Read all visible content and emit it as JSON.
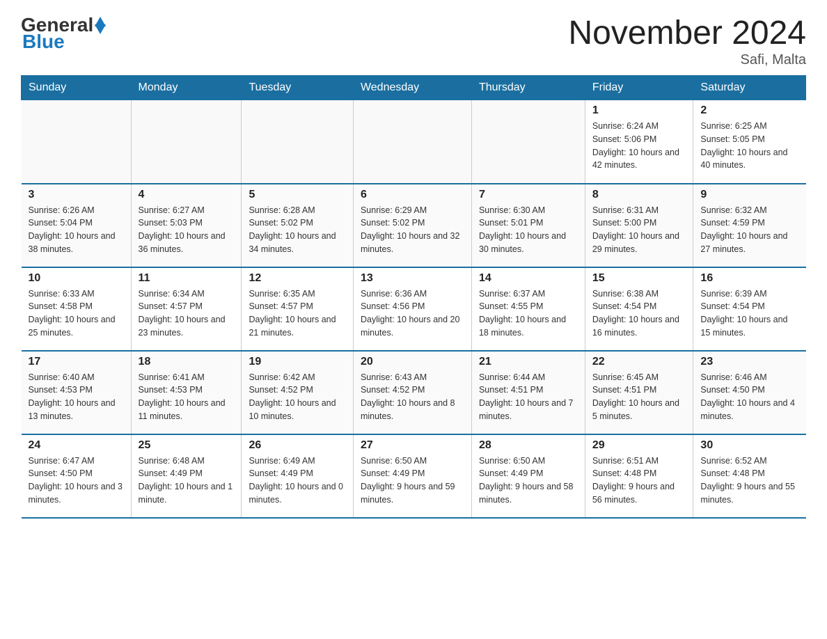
{
  "header": {
    "logo_general": "General",
    "logo_blue": "Blue",
    "month_title": "November 2024",
    "location": "Safi, Malta"
  },
  "days_of_week": [
    "Sunday",
    "Monday",
    "Tuesday",
    "Wednesday",
    "Thursday",
    "Friday",
    "Saturday"
  ],
  "weeks": [
    [
      {
        "day": "",
        "info": ""
      },
      {
        "day": "",
        "info": ""
      },
      {
        "day": "",
        "info": ""
      },
      {
        "day": "",
        "info": ""
      },
      {
        "day": "",
        "info": ""
      },
      {
        "day": "1",
        "info": "Sunrise: 6:24 AM\nSunset: 5:06 PM\nDaylight: 10 hours and 42 minutes."
      },
      {
        "day": "2",
        "info": "Sunrise: 6:25 AM\nSunset: 5:05 PM\nDaylight: 10 hours and 40 minutes."
      }
    ],
    [
      {
        "day": "3",
        "info": "Sunrise: 6:26 AM\nSunset: 5:04 PM\nDaylight: 10 hours and 38 minutes."
      },
      {
        "day": "4",
        "info": "Sunrise: 6:27 AM\nSunset: 5:03 PM\nDaylight: 10 hours and 36 minutes."
      },
      {
        "day": "5",
        "info": "Sunrise: 6:28 AM\nSunset: 5:02 PM\nDaylight: 10 hours and 34 minutes."
      },
      {
        "day": "6",
        "info": "Sunrise: 6:29 AM\nSunset: 5:02 PM\nDaylight: 10 hours and 32 minutes."
      },
      {
        "day": "7",
        "info": "Sunrise: 6:30 AM\nSunset: 5:01 PM\nDaylight: 10 hours and 30 minutes."
      },
      {
        "day": "8",
        "info": "Sunrise: 6:31 AM\nSunset: 5:00 PM\nDaylight: 10 hours and 29 minutes."
      },
      {
        "day": "9",
        "info": "Sunrise: 6:32 AM\nSunset: 4:59 PM\nDaylight: 10 hours and 27 minutes."
      }
    ],
    [
      {
        "day": "10",
        "info": "Sunrise: 6:33 AM\nSunset: 4:58 PM\nDaylight: 10 hours and 25 minutes."
      },
      {
        "day": "11",
        "info": "Sunrise: 6:34 AM\nSunset: 4:57 PM\nDaylight: 10 hours and 23 minutes."
      },
      {
        "day": "12",
        "info": "Sunrise: 6:35 AM\nSunset: 4:57 PM\nDaylight: 10 hours and 21 minutes."
      },
      {
        "day": "13",
        "info": "Sunrise: 6:36 AM\nSunset: 4:56 PM\nDaylight: 10 hours and 20 minutes."
      },
      {
        "day": "14",
        "info": "Sunrise: 6:37 AM\nSunset: 4:55 PM\nDaylight: 10 hours and 18 minutes."
      },
      {
        "day": "15",
        "info": "Sunrise: 6:38 AM\nSunset: 4:54 PM\nDaylight: 10 hours and 16 minutes."
      },
      {
        "day": "16",
        "info": "Sunrise: 6:39 AM\nSunset: 4:54 PM\nDaylight: 10 hours and 15 minutes."
      }
    ],
    [
      {
        "day": "17",
        "info": "Sunrise: 6:40 AM\nSunset: 4:53 PM\nDaylight: 10 hours and 13 minutes."
      },
      {
        "day": "18",
        "info": "Sunrise: 6:41 AM\nSunset: 4:53 PM\nDaylight: 10 hours and 11 minutes."
      },
      {
        "day": "19",
        "info": "Sunrise: 6:42 AM\nSunset: 4:52 PM\nDaylight: 10 hours and 10 minutes."
      },
      {
        "day": "20",
        "info": "Sunrise: 6:43 AM\nSunset: 4:52 PM\nDaylight: 10 hours and 8 minutes."
      },
      {
        "day": "21",
        "info": "Sunrise: 6:44 AM\nSunset: 4:51 PM\nDaylight: 10 hours and 7 minutes."
      },
      {
        "day": "22",
        "info": "Sunrise: 6:45 AM\nSunset: 4:51 PM\nDaylight: 10 hours and 5 minutes."
      },
      {
        "day": "23",
        "info": "Sunrise: 6:46 AM\nSunset: 4:50 PM\nDaylight: 10 hours and 4 minutes."
      }
    ],
    [
      {
        "day": "24",
        "info": "Sunrise: 6:47 AM\nSunset: 4:50 PM\nDaylight: 10 hours and 3 minutes."
      },
      {
        "day": "25",
        "info": "Sunrise: 6:48 AM\nSunset: 4:49 PM\nDaylight: 10 hours and 1 minute."
      },
      {
        "day": "26",
        "info": "Sunrise: 6:49 AM\nSunset: 4:49 PM\nDaylight: 10 hours and 0 minutes."
      },
      {
        "day": "27",
        "info": "Sunrise: 6:50 AM\nSunset: 4:49 PM\nDaylight: 9 hours and 59 minutes."
      },
      {
        "day": "28",
        "info": "Sunrise: 6:50 AM\nSunset: 4:49 PM\nDaylight: 9 hours and 58 minutes."
      },
      {
        "day": "29",
        "info": "Sunrise: 6:51 AM\nSunset: 4:48 PM\nDaylight: 9 hours and 56 minutes."
      },
      {
        "day": "30",
        "info": "Sunrise: 6:52 AM\nSunset: 4:48 PM\nDaylight: 9 hours and 55 minutes."
      }
    ]
  ]
}
